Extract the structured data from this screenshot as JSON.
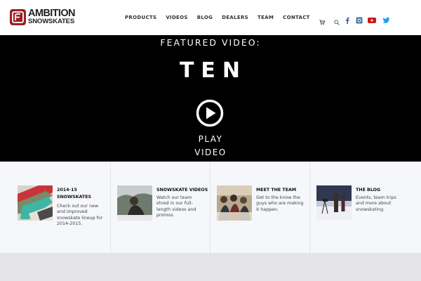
{
  "brand": {
    "line1": "AMBITION",
    "line2": "SNOWSKATES",
    "color": "#9c1f24"
  },
  "nav": {
    "items": [
      "PRODUCTS",
      "VIDEOS",
      "BLOG",
      "DEALERS",
      "TEAM",
      "CONTACT"
    ],
    "cart_icon": "cart-icon",
    "search_icon": "search-icon"
  },
  "social": {
    "facebook_color": "#3b5998",
    "instagram_color": "#3f729b",
    "youtube_color": "#cc181e",
    "twitter_color": "#1da1f2"
  },
  "hero": {
    "featured": "FEATURED VIDEO:",
    "title": "TEN",
    "play_line1": "PLAY",
    "play_line2": "VIDEO"
  },
  "cards": [
    {
      "title_line1": "2014-15",
      "title_line2": "SNOWSKATES",
      "text": [
        "Check out our new",
        "and improved",
        "snowskate lineup for",
        "2014-2015."
      ]
    },
    {
      "title_line1": "SNOWSKATE VIDEOS",
      "title_line2": "",
      "text": [
        "Watch our team",
        "shred in our full-",
        "length videos and",
        "promos."
      ]
    },
    {
      "title_line1": "MEET THE TEAM",
      "title_line2": "",
      "text": [
        "Get to the know the",
        "guys who are making",
        "it happen."
      ]
    },
    {
      "title_line1": "THE BLOG",
      "title_line2": "",
      "text": [
        "Events, team trips",
        "and more about",
        "snowskating."
      ]
    }
  ]
}
